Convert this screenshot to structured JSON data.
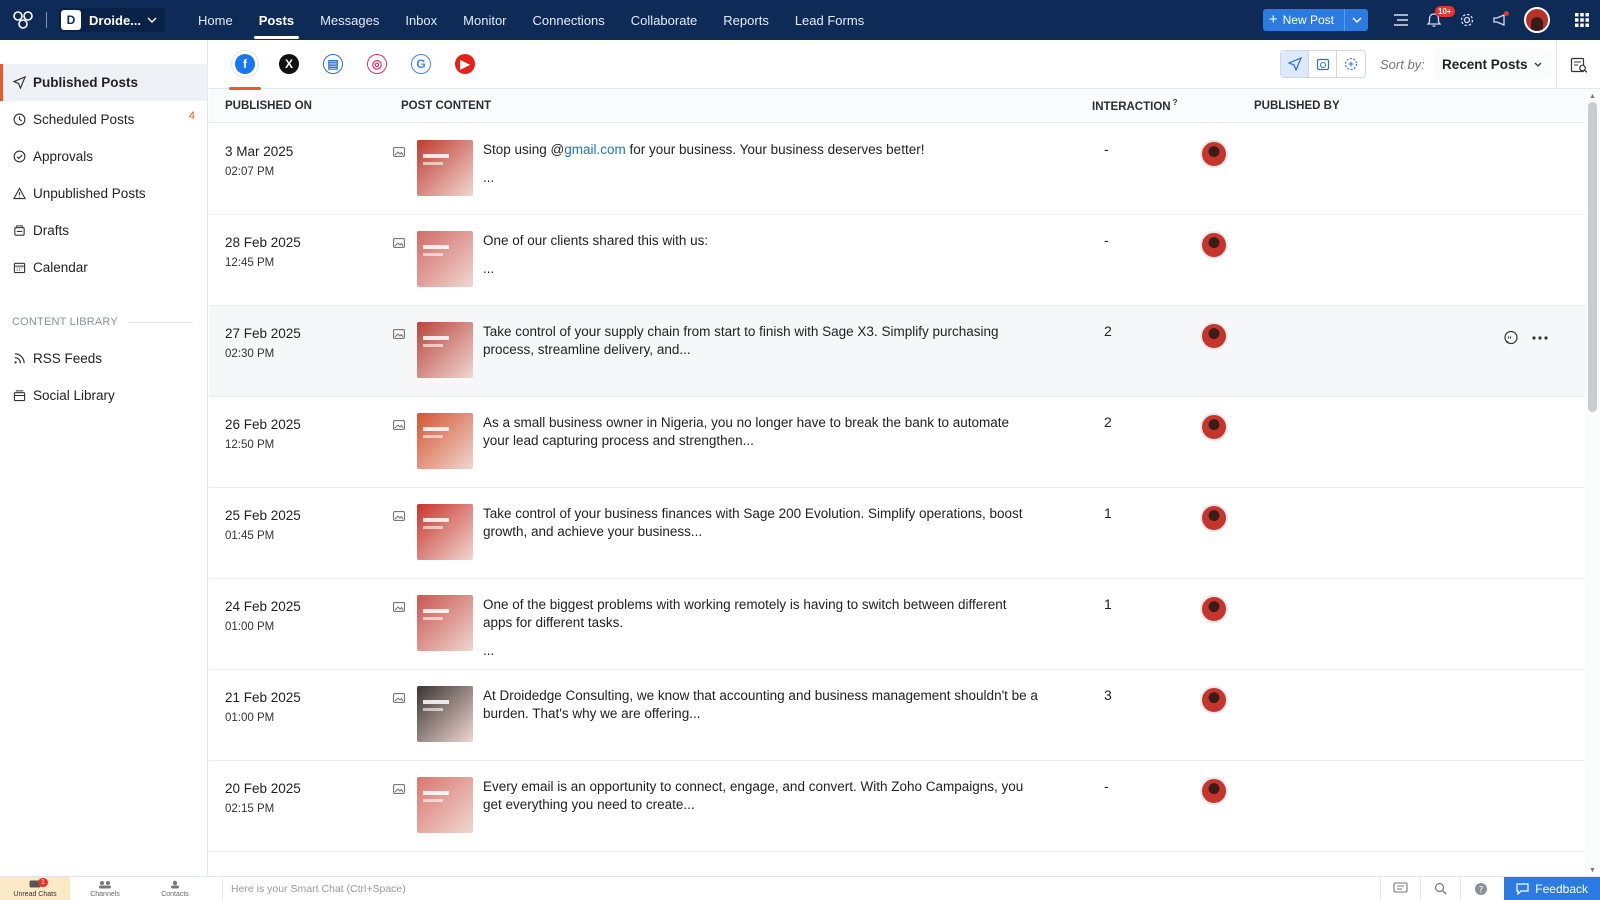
{
  "topbar": {
    "brand": "Droide...",
    "nav": [
      "Home",
      "Posts",
      "Messages",
      "Inbox",
      "Monitor",
      "Connections",
      "Collaborate",
      "Reports",
      "Lead Forms"
    ],
    "active_nav": "Posts",
    "new_post_label": "New Post",
    "notification_badge": "10+"
  },
  "sidebar": {
    "items": [
      {
        "label": "Published Posts",
        "icon": "send-icon",
        "active": true
      },
      {
        "label": "Scheduled Posts",
        "icon": "clock-icon",
        "count": "4"
      },
      {
        "label": "Approvals",
        "icon": "check-circle-icon"
      },
      {
        "label": "Unpublished Posts",
        "icon": "warning-icon"
      },
      {
        "label": "Drafts",
        "icon": "drafts-icon"
      },
      {
        "label": "Calendar",
        "icon": "calendar-icon"
      }
    ],
    "library_heading": "CONTENT LIBRARY",
    "library_items": [
      {
        "label": "RSS Feeds",
        "icon": "rss-icon"
      },
      {
        "label": "Social Library",
        "icon": "library-icon"
      }
    ]
  },
  "networks": [
    {
      "name": "facebook",
      "glyph": "f",
      "color": "#1877f2",
      "active": true
    },
    {
      "name": "x",
      "glyph": "X",
      "color": "#111111"
    },
    {
      "name": "linkedin-page",
      "glyph": "▤",
      "color": "#2f6fd3"
    },
    {
      "name": "instagram",
      "glyph": "◎",
      "color": "#e1306c"
    },
    {
      "name": "google-business",
      "glyph": "G",
      "color": "#4285f4"
    },
    {
      "name": "youtube",
      "glyph": "▶",
      "color": "#e62117"
    }
  ],
  "sort": {
    "label": "Sort by:",
    "value": "Recent Posts"
  },
  "columns": {
    "published_on": "PUBLISHED ON",
    "post_content": "POST CONTENT",
    "interaction": "INTERACTION",
    "interaction_sup": "?",
    "published_by": "PUBLISHED BY"
  },
  "posts": [
    {
      "date": "3 Mar 2025",
      "time": "02:07 PM",
      "text_before": "Stop using @",
      "highlight": "gmail.com",
      "text_after": " for your business. Your business deserves better!",
      "ellipsis": "...",
      "interaction": "-",
      "thumb": "#c13a2f"
    },
    {
      "date": "28 Feb 2025",
      "time": "12:45 PM",
      "text_before": "One of our clients shared this with us:",
      "highlight": "",
      "text_after": "",
      "ellipsis": "...",
      "interaction": "-",
      "thumb": "#d26a66"
    },
    {
      "date": "27 Feb 2025",
      "time": "02:30 PM",
      "text_before": "Take control of your supply chain from start to finish with Sage X3. Simplify purchasing process, streamline delivery, and...",
      "highlight": "",
      "text_after": "",
      "ellipsis": "",
      "interaction": "2",
      "thumb": "#b8453c"
    },
    {
      "date": "26 Feb 2025",
      "time": "12:50 PM",
      "text_before": "As a small business owner in Nigeria, you no longer have to break the bank to automate your lead capturing process and strengthen...",
      "highlight": "",
      "text_after": "",
      "ellipsis": "",
      "interaction": "2",
      "thumb": "#d4552f"
    },
    {
      "date": "25 Feb 2025",
      "time": "01:45 PM",
      "text_before": "Take control of your business finances with Sage 200 Evolution. Simplify operations, boost growth, and achieve your business...",
      "highlight": "",
      "text_after": "",
      "ellipsis": "",
      "interaction": "1",
      "thumb": "#c8342c"
    },
    {
      "date": "24 Feb 2025",
      "time": "01:00 PM",
      "text_before": "One of the biggest problems with working remotely is having to switch between different apps for different tasks.",
      "highlight": "",
      "text_after": "",
      "ellipsis": "...",
      "interaction": "1",
      "thumb": "#c9564f"
    },
    {
      "date": "21 Feb 2025",
      "time": "01:00 PM",
      "text_before": "At Droidedge Consulting, we know that accounting and business management shouldn't be a burden. That's why we are offering...",
      "highlight": "",
      "text_after": "",
      "ellipsis": "",
      "interaction": "3",
      "thumb": "#3b3532"
    },
    {
      "date": "20 Feb 2025",
      "time": "02:15 PM",
      "text_before": "Every email is an opportunity to connect, engage, and convert. With Zoho Campaigns, you get everything you need to create...",
      "highlight": "",
      "text_after": "",
      "ellipsis": "",
      "interaction": "-",
      "thumb": "#d9776e"
    }
  ],
  "hover_row_index": 2,
  "bottombar": {
    "tabs": [
      {
        "label": "Unread Chats",
        "badge": "1"
      },
      {
        "label": "Channels"
      },
      {
        "label": "Contacts"
      }
    ],
    "smart_chat_placeholder": "Here is your Smart Chat (Ctrl+Space)",
    "feedback_label": "Feedback"
  }
}
